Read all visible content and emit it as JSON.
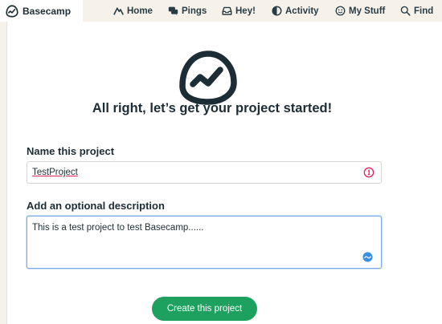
{
  "nav": {
    "brand": "Basecamp",
    "items": [
      {
        "label": "Home",
        "icon": "mountain-icon"
      },
      {
        "label": "Pings",
        "icon": "chat-bubbles-icon"
      },
      {
        "label": "Hey!",
        "icon": "inbox-icon"
      },
      {
        "label": "Activity",
        "icon": "half-circle-icon"
      },
      {
        "label": "My Stuff",
        "icon": "smiley-icon"
      },
      {
        "label": "Find",
        "icon": "search-icon"
      }
    ]
  },
  "main": {
    "heading": "All right, let’s get your project started!",
    "name_label": "Name this project",
    "name_value": "TestProject",
    "description_label": "Add an optional description",
    "description_value": "This is a test project to test Basecamp......",
    "create_button": "Create this project"
  },
  "colors": {
    "accent_green": "#1ea15f",
    "alert_pink": "#e0245e",
    "focus_blue": "#7db0e6",
    "background": "#f6f2ea"
  }
}
